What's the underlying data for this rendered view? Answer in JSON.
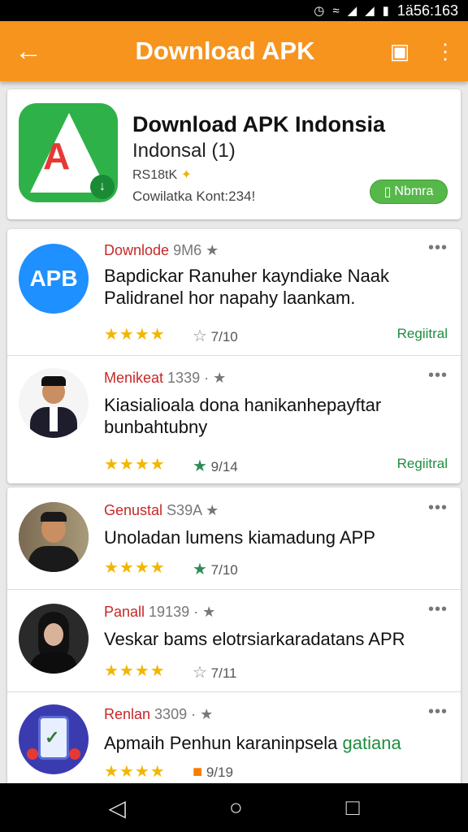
{
  "status_bar": {
    "time": "1ä56:163"
  },
  "app_bar": {
    "title": "Download APK"
  },
  "hero": {
    "name": "Download APK Indonsia",
    "subtitle": "Indonsal (1)",
    "meta": "RS18tK",
    "downloads": "Cowilatka Kont:234!",
    "button_label": "Nbmra"
  },
  "items": [
    {
      "header": "Downlode",
      "header_gray": " 9M6 ★",
      "body": "Bapdickar Ranuher kayndiake Naak Palidranel hor napahy laankam.",
      "body_green": "",
      "score": "7/10",
      "status": "Regiitral"
    },
    {
      "header": "Menikeat",
      "header_gray": " 1339 · ★",
      "body": "Kiasialioala dona hanikanhepayftar bunbahtubny",
      "body_green": "",
      "score": "9/14",
      "status": "Regiitral"
    },
    {
      "header": "Genustal",
      "header_gray": " S39A ★",
      "body": "Unoladan lumens kiamadung APP",
      "body_green": "",
      "score": "7/10",
      "status": ""
    },
    {
      "header": "Panall",
      "header_gray": " 19139 · ★",
      "body": "Veskar bams elotrsiarkaradatans APR",
      "body_green": "",
      "score": "7/11",
      "status": ""
    },
    {
      "header": "Renlan",
      "header_gray": " 3309 · ★",
      "body": "Apmaih Penhun karaninpsela ",
      "body_green": "gatiana",
      "score": "9/19",
      "status": ""
    }
  ],
  "apb_icon_text": "APB",
  "colors": {
    "accent": "#f7941d",
    "green": "#1e8e3e",
    "red": "#c62828",
    "star": "#f2b600"
  }
}
